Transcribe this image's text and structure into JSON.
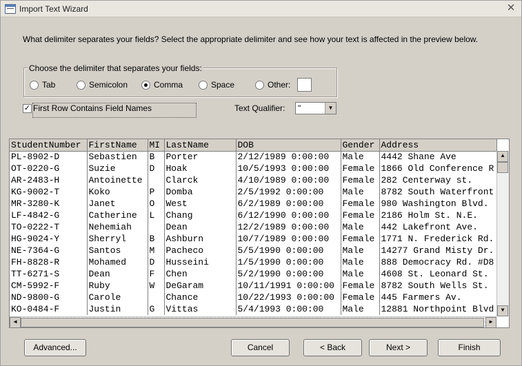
{
  "window": {
    "title": "Import Text Wizard"
  },
  "prompt": "What delimiter separates your fields? Select the appropriate delimiter and see how your text is affected in the preview below.",
  "delimiter": {
    "legend": "Choose the delimiter that separates your fields:",
    "options": [
      {
        "label": "Tab",
        "selected": false
      },
      {
        "label": "Semicolon",
        "selected": false
      },
      {
        "label": "Comma",
        "selected": true
      },
      {
        "label": "Space",
        "selected": false
      },
      {
        "label": "Other:",
        "selected": false
      }
    ],
    "other_value": ""
  },
  "first_row": {
    "label": "First Row Contains Field Names",
    "checked": true
  },
  "text_qualifier": {
    "label": "Text Qualifier:",
    "value": "\""
  },
  "preview": {
    "columns": [
      "StudentNumber",
      "FirstName",
      "MI",
      "LastName",
      "DOB",
      "Gender",
      "Address"
    ],
    "rows": [
      [
        "PL-8902-D",
        "Sebastien",
        "B",
        "Porter",
        "2/12/1989 0:00:00",
        "Male",
        "4442 Shane Ave"
      ],
      [
        "OT-0220-G",
        "Suzie",
        "D",
        "Hoak",
        "10/5/1993 0:00:00",
        "Female",
        "1866 Old Conference R"
      ],
      [
        "AR-2483-H",
        "Antoinette",
        "",
        "Clarck",
        "4/10/1989 0:00:00",
        "Female",
        "282 Centerway st."
      ],
      [
        "KG-9002-T",
        "Koko",
        "P",
        "Domba",
        "2/5/1992 0:00:00",
        "Male",
        "8782 South Waterfront"
      ],
      [
        "MR-3280-K",
        "Janet",
        "O",
        "West",
        "6/2/1989 0:00:00",
        "Female",
        "980 Washington Blvd."
      ],
      [
        "LF-4842-G",
        "Catherine",
        "L",
        "Chang",
        "6/12/1990 0:00:00",
        "Female",
        "2186 Holm St. N.E."
      ],
      [
        "TO-0222-T",
        "Nehemiah",
        "",
        "Dean",
        "12/2/1989 0:00:00",
        "Male",
        "442 Lakefront Ave."
      ],
      [
        "HG-9024-Y",
        "Sherryl",
        "B",
        "Ashburn",
        "10/7/1989 0:00:00",
        "Female",
        "1771 N. Frederick Rd."
      ],
      [
        "NE-7364-G",
        "Santos",
        "M",
        "Pacheco",
        "5/5/1990 0:00:00",
        "Male",
        "14277 Grand Misty Dr."
      ],
      [
        "FH-8828-R",
        "Mohamed",
        "D",
        "Husseini",
        "1/5/1990 0:00:00",
        "Male",
        "888 Democracy Rd. #D8"
      ],
      [
        "TT-6271-S",
        "Dean",
        "F",
        "Chen",
        "5/2/1990 0:00:00",
        "Male",
        "4608 St. Leonard St."
      ],
      [
        "CM-5992-F",
        "Ruby",
        "W",
        "DeGaram",
        "10/11/1991 0:00:00",
        "Female",
        "8782 South Wells St."
      ],
      [
        "ND-9800-G",
        "Carole",
        "",
        "Chance",
        "10/22/1993 0:00:00",
        "Female",
        "445 Farmers Av."
      ],
      [
        "KO-0484-F",
        "Justin",
        "G",
        "Vittas",
        "5/4/1993 0:00:00",
        "Male",
        "12881 Northpoint Blvd"
      ]
    ]
  },
  "buttons": {
    "advanced": "Advanced...",
    "cancel": "Cancel",
    "back": "< Back",
    "next": "Next >",
    "finish": "Finish"
  },
  "icons": {
    "app": "wizard-app-icon",
    "close": "close-icon",
    "check": "✓",
    "down": "▼",
    "up": "▲",
    "left": "◀",
    "right": "▶"
  }
}
